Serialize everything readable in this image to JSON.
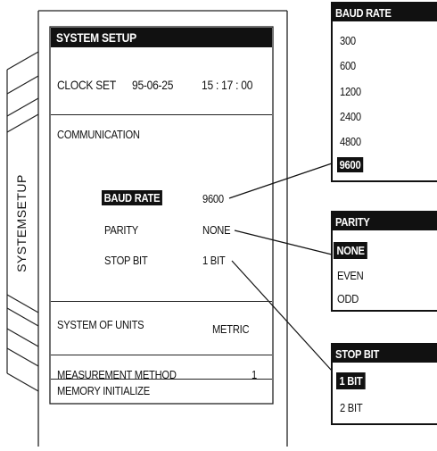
{
  "side_tab": {
    "label": "SYSTEMSETUP"
  },
  "main_panel": {
    "title": "SYSTEM SETUP",
    "clock_label": "CLOCK SET",
    "clock_date": "95-06-25",
    "clock_time": "15 : 17 : 00",
    "communication_heading": "COMMUNICATION",
    "settings": [
      {
        "label": "BAUD RATE",
        "value": "9600",
        "selected": true
      },
      {
        "label": "PARITY",
        "value": "NONE",
        "selected": false
      },
      {
        "label": "STOP BIT",
        "value": "1 BIT",
        "selected": false
      }
    ],
    "units_label": "SYSTEM OF UNITS",
    "units_value": "METRIC",
    "measurement_label": "MEASUREMENT METHOD",
    "measurement_value": "1",
    "memory_label": "MEMORY INITIALIZE"
  },
  "popups": {
    "baud_rate": {
      "title": "BAUD RATE",
      "options": [
        "300",
        "600",
        "1200",
        "2400",
        "4800",
        "9600"
      ],
      "selected": "9600"
    },
    "parity": {
      "title": "PARITY",
      "options": [
        "NONE",
        "EVEN",
        "ODD"
      ],
      "selected": "NONE"
    },
    "stop_bit": {
      "title": "STOP BIT",
      "options": [
        "1 BIT",
        "2 BIT"
      ],
      "selected": "1 BIT"
    }
  }
}
